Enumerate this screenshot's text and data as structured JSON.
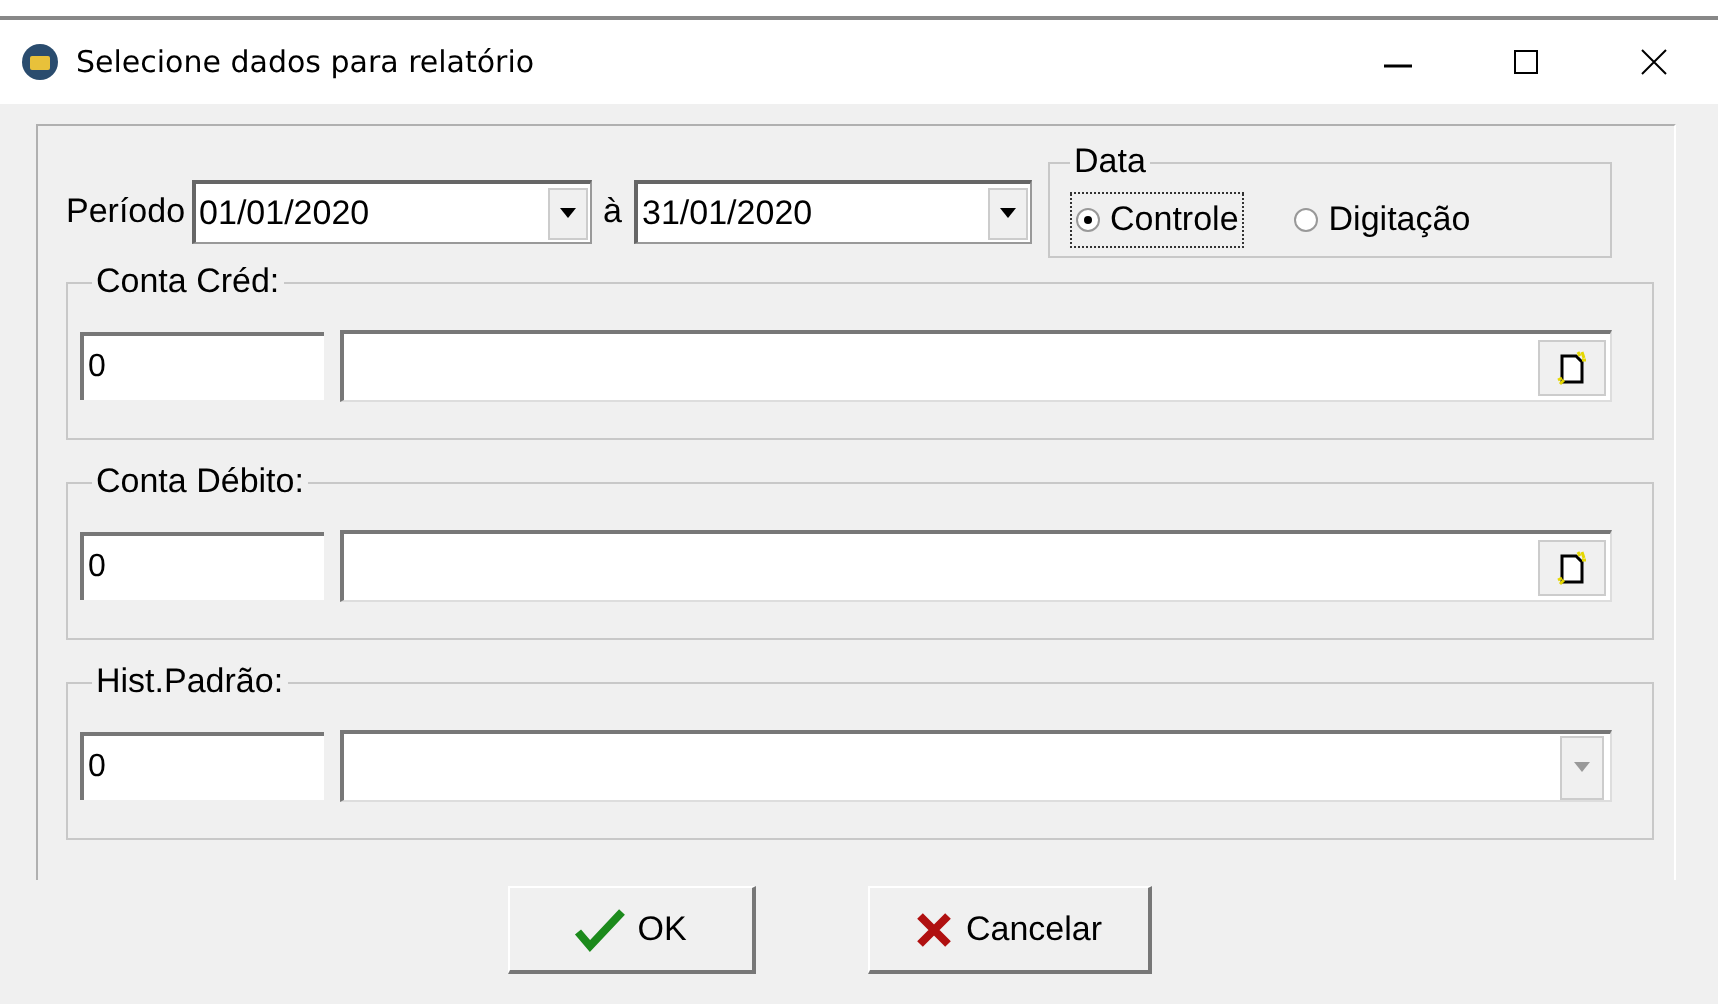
{
  "window": {
    "title": "Selecione dados para relatório"
  },
  "period": {
    "label": "Período",
    "from": "01/01/2020",
    "separator": "à",
    "to": "31/01/2020"
  },
  "date_group": {
    "label": "Data",
    "options": [
      {
        "label": "Controle",
        "selected": true,
        "focused": true
      },
      {
        "label": "Digitação",
        "selected": false,
        "focused": false
      }
    ]
  },
  "groups": [
    {
      "label": "Conta Créd:",
      "code": "0",
      "kind": "lookup"
    },
    {
      "label": "Conta Débito:",
      "code": "0",
      "kind": "lookup"
    },
    {
      "label": "Hist.Padrão:",
      "code": "0",
      "kind": "combo"
    }
  ],
  "buttons": [
    {
      "label": "OK",
      "kind": "ok"
    },
    {
      "label": "Cancelar",
      "kind": "cancel"
    }
  ]
}
